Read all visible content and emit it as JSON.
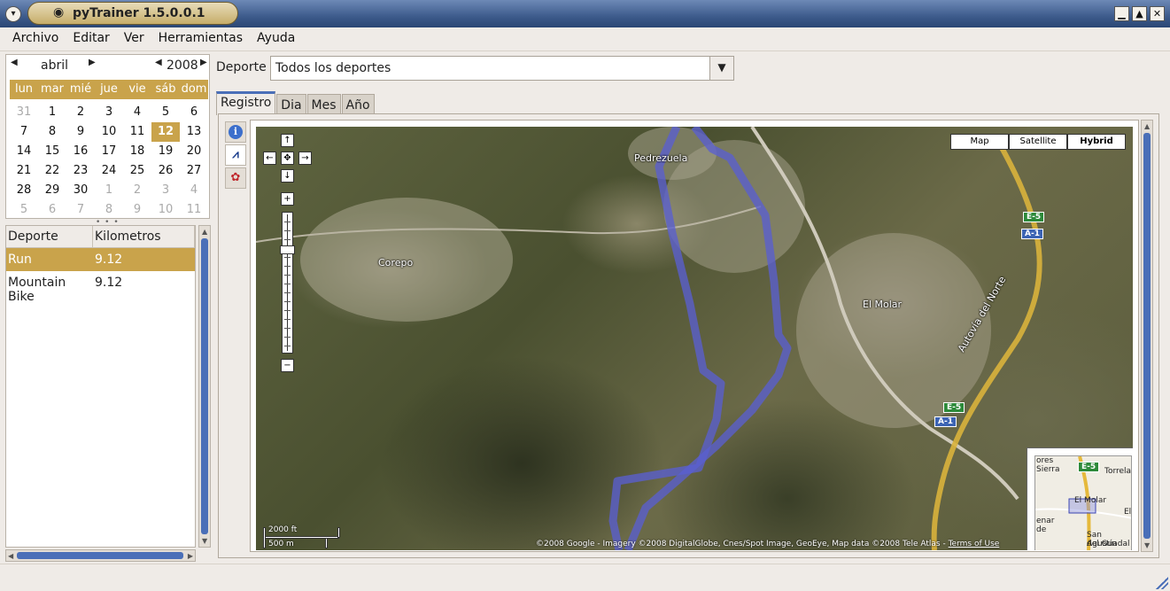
{
  "window": {
    "title": "pyTrainer 1.5.0.0.1",
    "buttons": {
      "minimize": "▁",
      "maximize": "▲",
      "close": "✕"
    }
  },
  "menu": [
    "Archivo",
    "Editar",
    "Ver",
    "Herramientas",
    "Ayuda"
  ],
  "calendar": {
    "month": "abril",
    "year": "2008",
    "weekdays": [
      "lun",
      "mar",
      "mié",
      "jue",
      "vie",
      "sáb",
      "dom"
    ],
    "weeks": [
      [
        "31",
        "1",
        "2",
        "3",
        "4",
        "5",
        "6"
      ],
      [
        "7",
        "8",
        "9",
        "10",
        "11",
        "12",
        "13"
      ],
      [
        "14",
        "15",
        "16",
        "17",
        "18",
        "19",
        "20"
      ],
      [
        "21",
        "22",
        "23",
        "24",
        "25",
        "26",
        "27"
      ],
      [
        "28",
        "29",
        "30",
        "1",
        "2",
        "3",
        "4"
      ],
      [
        "5",
        "6",
        "7",
        "8",
        "9",
        "10",
        "11"
      ]
    ],
    "selected_day": "12"
  },
  "sport_list": {
    "headers": [
      "Deporte",
      "Kilometros"
    ],
    "rows": [
      {
        "sport": "Run",
        "km": "9.12"
      },
      {
        "sport": "Mountain Bike",
        "km": "9.12"
      }
    ],
    "selected_index": 0
  },
  "sport_filter": {
    "label": "Deporte",
    "value": "Todos los deportes"
  },
  "tabs": [
    "Registro",
    "Dia",
    "Mes",
    "Año"
  ],
  "active_tab": "Registro",
  "map": {
    "types": [
      "Map",
      "Satellite",
      "Hybrid"
    ],
    "active_type": "Hybrid",
    "places": [
      "Pedrezuela",
      "Corepo",
      "El Molar",
      "Autovía del Norte"
    ],
    "road_shields": {
      "e": "E-5",
      "a": "A-1"
    },
    "scale": {
      "top": "2000 ft",
      "bottom": "500 m"
    },
    "copyright": "©2008 Google - Imagery ©2008 DigitalGlobe, Cnes/Spot Image, GeoEye, Map data ©2008 Tele Atlas - ",
    "terms": "Terms of Use",
    "overview": {
      "labels": [
        "ores",
        "Sierra",
        "Torrelag",
        "El Molar",
        "enar",
        "de",
        "San Agustín",
        "del Guadal",
        "El"
      ]
    },
    "route_color": "#5a5fd0"
  },
  "colors": {
    "accent": "#c9a34b",
    "scroll": "#4a6fb8"
  }
}
